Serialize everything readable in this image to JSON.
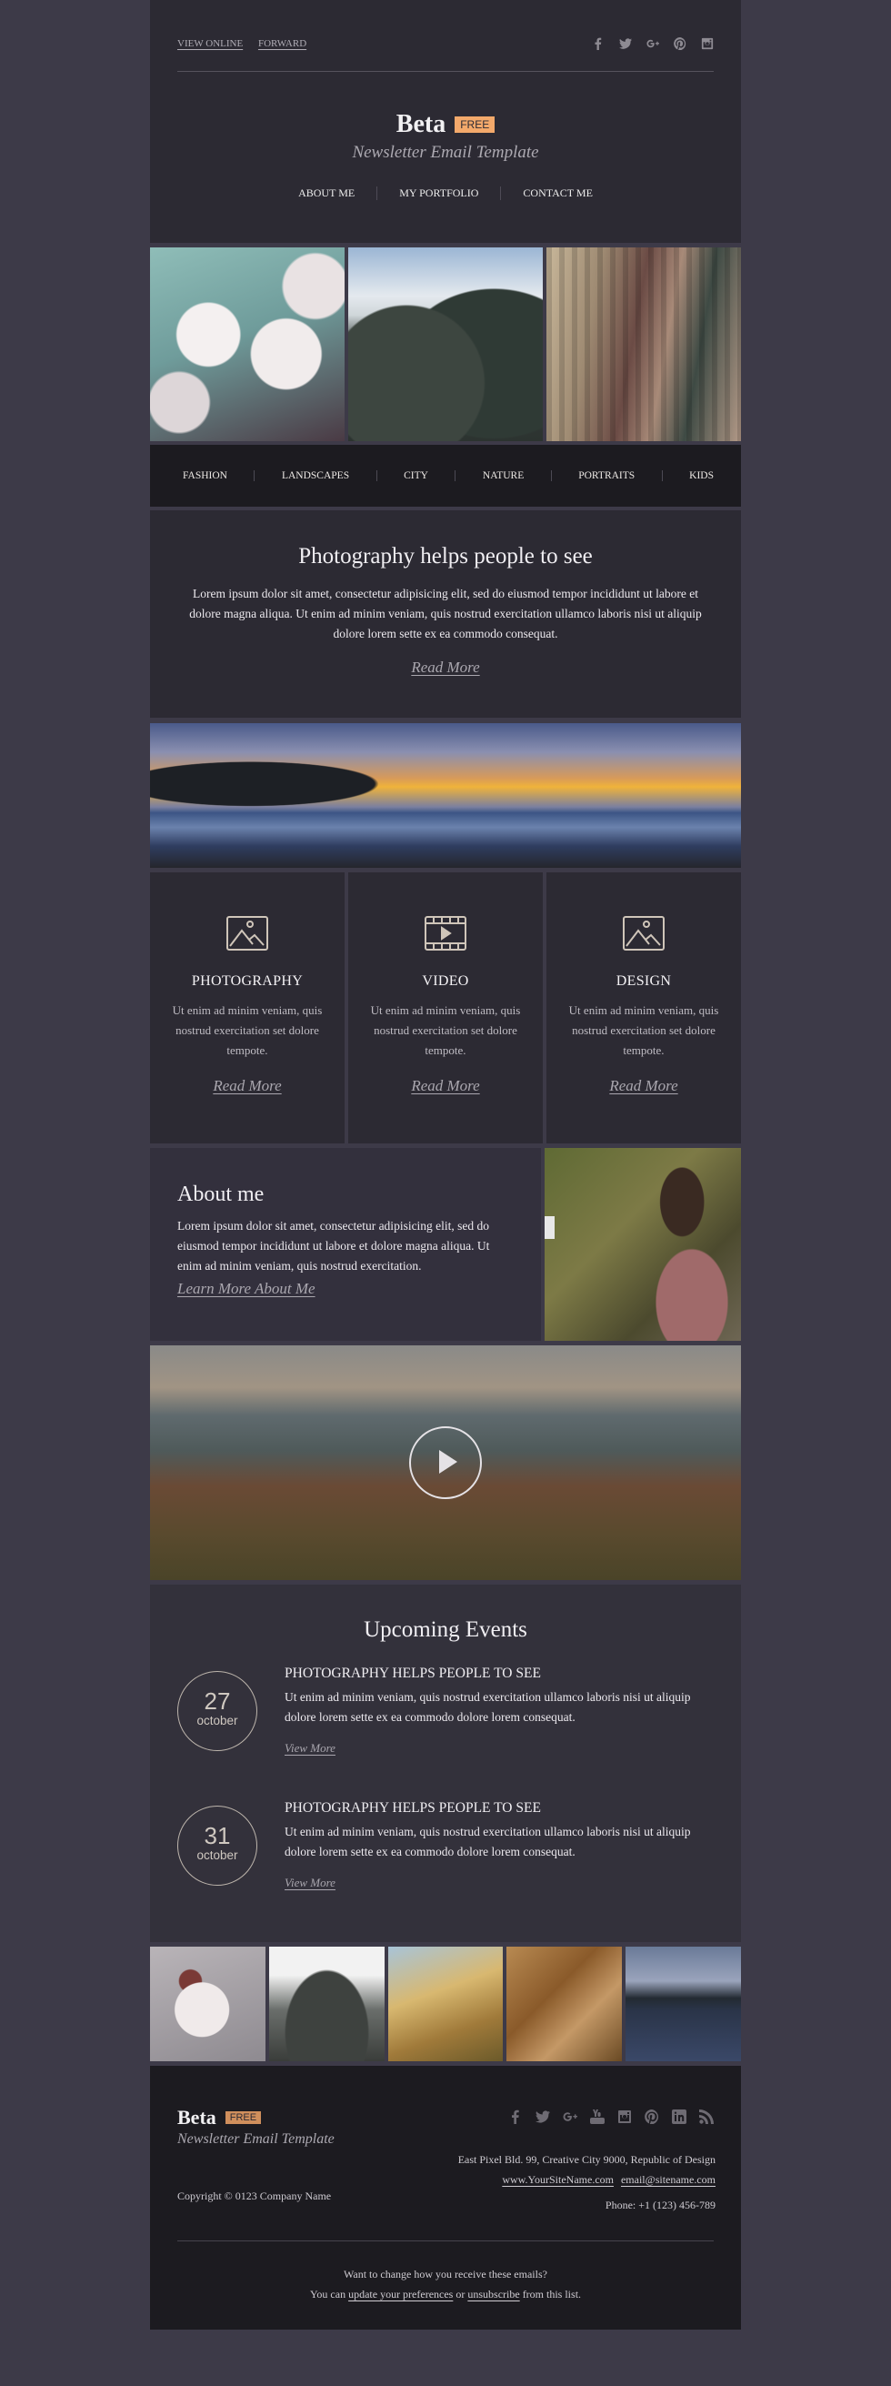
{
  "colors": {
    "page_bg": "#3d3a48",
    "panel": "#2c2a33",
    "dark": "#1c1b20",
    "accent_badge": "#f3a96b"
  },
  "header": {
    "links": [
      "VIEW ONLINE",
      "FORWARD"
    ],
    "social": [
      "facebook-icon",
      "twitter-icon",
      "google-plus-icon",
      "pinterest-icon",
      "instagram-icon"
    ],
    "brand": "Beta",
    "badge": "FREE",
    "tagline": "Newsletter Email Template",
    "nav": [
      "ABOUT ME",
      "MY PORTFOLIO",
      "CONTACT ME"
    ]
  },
  "hero_images": [
    {
      "alt": "cherry blossoms"
    },
    {
      "alt": "snowy pine trees"
    },
    {
      "alt": "city skyscrapers"
    }
  ],
  "categories": [
    "FASHION",
    "LANDSCAPES",
    "CITY",
    "NATURE",
    "PORTRAITS",
    "KIDS"
  ],
  "intro": {
    "title": "Photography helps people to see",
    "body": "Lorem ipsum dolor sit amet, consectetur adipisicing elit, sed do eiusmod tempor incididunt ut labore et dolore magna aliqua. Ut enim ad minim veniam, quis nostrud exercitation ullamco laboris nisi ut aliquip dolore lorem sette ex ea commodo consequat.",
    "link": "Read More"
  },
  "banner": {
    "alt": "sunset seascape"
  },
  "services": [
    {
      "icon": "image-icon",
      "title": "PHOTOGRAPHY",
      "body": "Ut enim ad minim veniam, quis nostrud exercitation set dolore tempote.",
      "link": "Read More"
    },
    {
      "icon": "video-icon",
      "title": "VIDEO",
      "body": "Ut enim ad minim veniam, quis nostrud exercitation set dolore tempote.",
      "link": "Read More"
    },
    {
      "icon": "image-icon",
      "title": "DESIGN",
      "body": "Ut enim ad minim veniam, quis nostrud exercitation set dolore tempote.",
      "link": "Read More"
    }
  ],
  "about": {
    "title": "About me",
    "body": "Lorem ipsum dolor sit amet, consectetur adipisicing elit, sed do eiusmod tempor incididunt ut labore et dolore magna aliqua. Ut enim ad minim veniam, quis nostrud exercitation.",
    "link": "Learn More About Me"
  },
  "video": {
    "alt": "mountain landscape video"
  },
  "events": {
    "title": "Upcoming Events",
    "items": [
      {
        "day": "27",
        "month": "october",
        "title": "PHOTOGRAPHY HELPS PEOPLE TO SEE",
        "body": "Ut enim ad minim veniam, quis nostrud exercitation ullamco laboris nisi ut aliquip dolore lorem sette ex ea commodo dolore lorem consequat.",
        "link": "View More"
      },
      {
        "day": "31",
        "month": "october",
        "title": "PHOTOGRAPHY HELPS PEOPLE TO SEE",
        "body": "Ut enim ad minim veniam, quis nostrud exercitation ullamco laboris nisi ut aliquip dolore lorem sette ex ea commodo dolore lorem consequat.",
        "link": "View More"
      }
    ]
  },
  "footer": {
    "brand": "Beta",
    "badge": "FREE",
    "tagline": "Newsletter Email Template",
    "copyright": "Copyright © 0123 Company Name",
    "social": [
      "facebook-icon",
      "twitter-icon",
      "google-plus-icon",
      "youtube-icon",
      "instagram-icon",
      "pinterest-icon",
      "linkedin-icon",
      "rss-icon"
    ],
    "address": "East Pixel Bld. 99, Creative City 9000, Republic of Design",
    "website": "www.YourSiteName.com",
    "email": "email@sitename.com",
    "phone": "Phone: +1 (123) 456-789",
    "unsub_q": "Want to change how you receive these emails?",
    "unsub_pre": "You can",
    "unsub_prefs": "update your preferences",
    "unsub_or": "or",
    "unsub_link": "unsubscribe",
    "unsub_post": "from this list."
  }
}
